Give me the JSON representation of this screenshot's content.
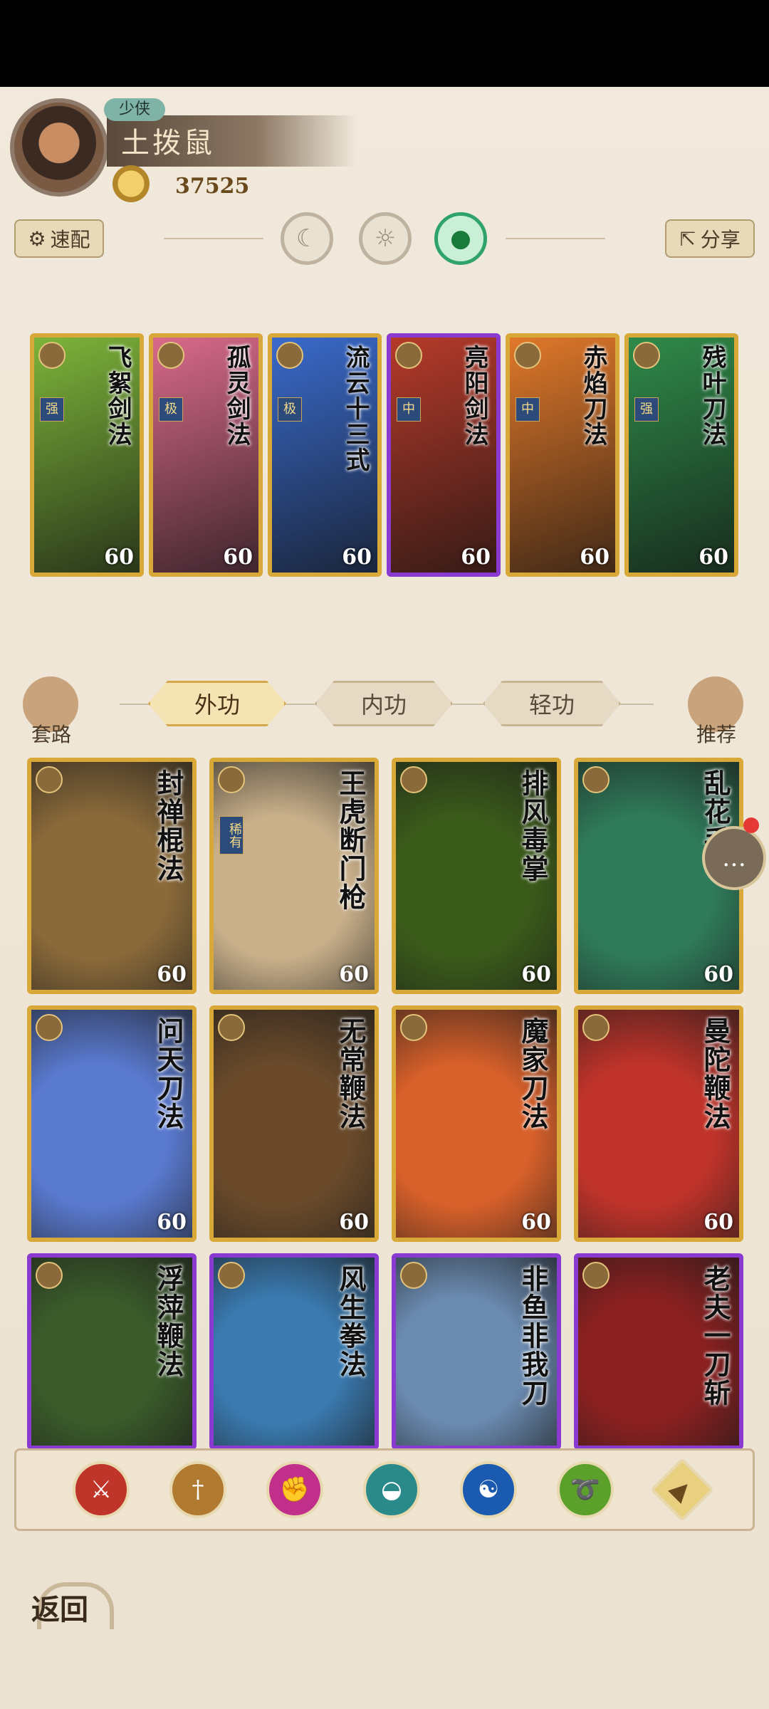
{
  "profile": {
    "rank": "少侠",
    "name": "土拨鼠",
    "power": "37525"
  },
  "toolbar": {
    "quick_config": "速配",
    "share": "分享"
  },
  "equipped_cards": [
    {
      "title": "飞絮剑法",
      "level": "60",
      "tag": "强",
      "color": "#7db43a"
    },
    {
      "title": "孤灵剑法",
      "level": "60",
      "tag": "极",
      "color": "#d96a8a"
    },
    {
      "title": "流云十三式",
      "level": "60",
      "tag": "极",
      "color": "#3a6acb"
    },
    {
      "title": "亮阳剑法",
      "level": "60",
      "tag": "中",
      "color": "#b53a2a",
      "purple": true
    },
    {
      "title": "赤焰刀法",
      "level": "60",
      "tag": "中",
      "color": "#e0782a"
    },
    {
      "title": "残叶刀法",
      "level": "60",
      "tag": "强",
      "color": "#2f8a4a"
    }
  ],
  "tabs": {
    "set": "套路",
    "outer": "外功",
    "inner": "内功",
    "light": "轻功",
    "recommend": "推荐"
  },
  "skill_cards": [
    {
      "title": "封禅棍法",
      "level": "60",
      "color": "#8b6a3a"
    },
    {
      "title": "王虎断门枪",
      "level": "60",
      "rare": "稀有",
      "color": "#c9b08a"
    },
    {
      "title": "排风毒掌",
      "level": "60",
      "color": "#3a5a1a"
    },
    {
      "title": "乱花手",
      "level": "60",
      "color": "#2f7a5a"
    },
    {
      "title": "问天刀法",
      "level": "60",
      "color": "#5a7ad0"
    },
    {
      "title": "无常鞭法",
      "level": "60",
      "color": "#6a4a2a"
    },
    {
      "title": "魔家刀法",
      "level": "60",
      "color": "#d8602a"
    },
    {
      "title": "曼陀鞭法",
      "level": "60",
      "color": "#c0332a"
    },
    {
      "title": "浮萍鞭法",
      "level": "",
      "color": "#3a5a2a",
      "purple": true
    },
    {
      "title": "风生拳法",
      "level": "",
      "color": "#3a7ab0",
      "purple": true
    },
    {
      "title": "非鱼非我刀",
      "level": "",
      "color": "#6a8ab0",
      "purple": true
    },
    {
      "title": "老夫一刀斩",
      "level": "",
      "color": "#8a2020",
      "purple": true
    }
  ],
  "filters": [
    {
      "name": "sword",
      "color": "#c0352a",
      "glyph": "⚔"
    },
    {
      "name": "dagger",
      "color": "#b07a30",
      "glyph": "†"
    },
    {
      "name": "fist",
      "color": "#c0308a",
      "glyph": "✊"
    },
    {
      "name": "fan",
      "color": "#2a8a8a",
      "glyph": "◒"
    },
    {
      "name": "taiji",
      "color": "#1a5ab0",
      "glyph": "☯"
    },
    {
      "name": "whip",
      "color": "#5aa02a",
      "glyph": "➰"
    },
    {
      "name": "all",
      "color": "#e8d080",
      "glyph": "▲"
    }
  ],
  "back": "返回"
}
